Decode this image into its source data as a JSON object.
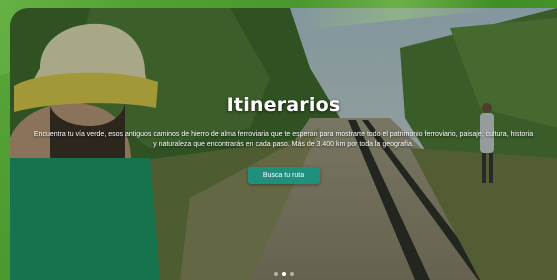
{
  "hero": {
    "title": "Itinerarios",
    "description": "Encuentra tu vía verde, esos antiguos caminos de hierro de alma ferroviaria que te esperan para mostrarte todo el patrimonio ferroviario, paisaje, cultura, historia y naturaleza que encontrarás en cada paso. Más de 3.400 km por toda la geografía.",
    "button_label": "Busca tu ruta",
    "slide_count": 3,
    "active_slide": 1
  },
  "colors": {
    "frame_green": "#4a9a2e",
    "button_teal": "#1f8f7e",
    "text": "#ffffff"
  }
}
